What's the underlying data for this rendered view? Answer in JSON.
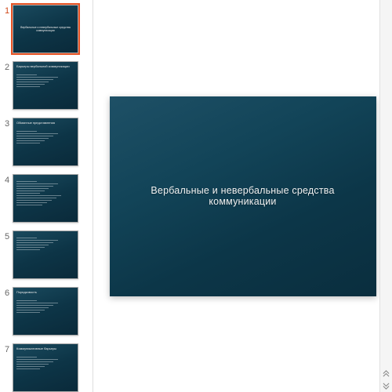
{
  "slide_title": "Вербальные  и невербальные средства коммуникации",
  "selected_index": 1,
  "thumbs": [
    {
      "num": "1",
      "title_center": "Вербальные и невербальные средства коммуникации"
    },
    {
      "num": "2",
      "title": "Барьеры вербальной коммуникации",
      "has_body": true
    },
    {
      "num": "3",
      "title": "Обманные представления",
      "has_body": true
    },
    {
      "num": "4",
      "title": "",
      "has_body": true,
      "body_tall": true
    },
    {
      "num": "5",
      "title": "",
      "has_body": true
    },
    {
      "num": "6",
      "title": "Порядковость",
      "has_body": true
    },
    {
      "num": "7",
      "title": "Коммуникативные барьеры",
      "has_body": true
    }
  ],
  "scroll_icons": {
    "up": "up-double-chevron",
    "down": "down-double-chevron"
  }
}
